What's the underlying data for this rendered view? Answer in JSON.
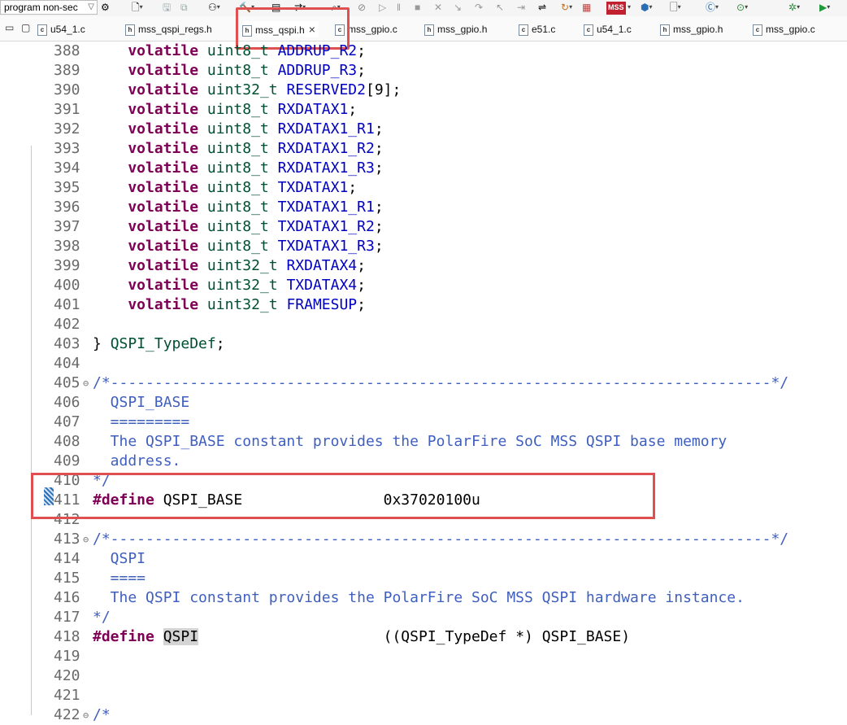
{
  "toolbar": {
    "run_config": "program non-sec",
    "icons": [
      "settings-icon",
      "new-file-icon",
      "save-icon",
      "save-all-icon",
      "debug-config-icon",
      "build-icon",
      "tools-icon",
      "console-icon",
      "search-icon",
      "skip-icon",
      "resume-icon",
      "suspend-icon",
      "terminate-icon",
      "disconnect-icon",
      "step-into-icon",
      "step-over-icon",
      "step-return-icon",
      "mss-configurator-icon",
      "external-tools-icon",
      "new-class-icon",
      "run-icon",
      "debug-icon"
    ],
    "mss_label": "MSS"
  },
  "view_controls": {
    "minimize": "▭",
    "maximize": "▢"
  },
  "tabs": [
    {
      "label": "u54_1.c",
      "type": "c",
      "active": false
    },
    {
      "label": "mss_qspi_regs.h",
      "type": "h",
      "active": false
    },
    {
      "label": "mss_qspi.h",
      "type": "h",
      "active": true
    },
    {
      "label": "mss_gpio.c",
      "type": "c",
      "active": false
    },
    {
      "label": "mss_gpio.h",
      "type": "h",
      "active": false
    },
    {
      "label": "e51.c",
      "type": "c",
      "active": false
    },
    {
      "label": "u54_1.c",
      "type": "c",
      "active": false
    },
    {
      "label": "mss_gpio.h",
      "type": "h",
      "active": false
    },
    {
      "label": "mss_gpio.c",
      "type": "c",
      "active": false
    }
  ],
  "tab_close_glyph": "×",
  "code_lines": [
    {
      "n": "388",
      "segs": [
        [
          "kw",
          "    volatile "
        ],
        [
          "ty",
          "uint8_t "
        ],
        [
          "fld",
          "ADDRUP_R2"
        ],
        [
          "txt",
          ";"
        ]
      ]
    },
    {
      "n": "389",
      "segs": [
        [
          "kw",
          "    volatile "
        ],
        [
          "ty",
          "uint8_t "
        ],
        [
          "fld",
          "ADDRUP_R3"
        ],
        [
          "txt",
          ";"
        ]
      ]
    },
    {
      "n": "390",
      "segs": [
        [
          "kw",
          "    volatile "
        ],
        [
          "ty",
          "uint32_t "
        ],
        [
          "fld",
          "RESERVED2"
        ],
        [
          "txt",
          "[9];"
        ]
      ]
    },
    {
      "n": "391",
      "segs": [
        [
          "kw",
          "    volatile "
        ],
        [
          "ty",
          "uint8_t "
        ],
        [
          "fld",
          "RXDATAX1"
        ],
        [
          "txt",
          ";"
        ]
      ]
    },
    {
      "n": "392",
      "segs": [
        [
          "kw",
          "    volatile "
        ],
        [
          "ty",
          "uint8_t "
        ],
        [
          "fld",
          "RXDATAX1_R1"
        ],
        [
          "txt",
          ";"
        ]
      ]
    },
    {
      "n": "393",
      "segs": [
        [
          "kw",
          "    volatile "
        ],
        [
          "ty",
          "uint8_t "
        ],
        [
          "fld",
          "RXDATAX1_R2"
        ],
        [
          "txt",
          ";"
        ]
      ]
    },
    {
      "n": "394",
      "segs": [
        [
          "kw",
          "    volatile "
        ],
        [
          "ty",
          "uint8_t "
        ],
        [
          "fld",
          "RXDATAX1_R3"
        ],
        [
          "txt",
          ";"
        ]
      ]
    },
    {
      "n": "395",
      "segs": [
        [
          "kw",
          "    volatile "
        ],
        [
          "ty",
          "uint8_t "
        ],
        [
          "fld",
          "TXDATAX1"
        ],
        [
          "txt",
          ";"
        ]
      ]
    },
    {
      "n": "396",
      "segs": [
        [
          "kw",
          "    volatile "
        ],
        [
          "ty",
          "uint8_t "
        ],
        [
          "fld",
          "TXDATAX1_R1"
        ],
        [
          "txt",
          ";"
        ]
      ]
    },
    {
      "n": "397",
      "segs": [
        [
          "kw",
          "    volatile "
        ],
        [
          "ty",
          "uint8_t "
        ],
        [
          "fld",
          "TXDATAX1_R2"
        ],
        [
          "txt",
          ";"
        ]
      ]
    },
    {
      "n": "398",
      "segs": [
        [
          "kw",
          "    volatile "
        ],
        [
          "ty",
          "uint8_t "
        ],
        [
          "fld",
          "TXDATAX1_R3"
        ],
        [
          "txt",
          ";"
        ]
      ]
    },
    {
      "n": "399",
      "segs": [
        [
          "kw",
          "    volatile "
        ],
        [
          "ty",
          "uint32_t "
        ],
        [
          "fld",
          "RXDATAX4"
        ],
        [
          "txt",
          ";"
        ]
      ]
    },
    {
      "n": "400",
      "segs": [
        [
          "kw",
          "    volatile "
        ],
        [
          "ty",
          "uint32_t "
        ],
        [
          "fld",
          "TXDATAX4"
        ],
        [
          "txt",
          ";"
        ]
      ]
    },
    {
      "n": "401",
      "segs": [
        [
          "kw",
          "    volatile "
        ],
        [
          "ty",
          "uint32_t "
        ],
        [
          "fld",
          "FRAMESUP"
        ],
        [
          "txt",
          ";"
        ]
      ]
    },
    {
      "n": "402",
      "segs": []
    },
    {
      "n": "403",
      "segs": [
        [
          "txt",
          "} "
        ],
        [
          "ty",
          "QSPI_TypeDef"
        ],
        [
          "txt",
          ";"
        ]
      ]
    },
    {
      "n": "404",
      "segs": []
    },
    {
      "n": "405",
      "fold": true,
      "segs": [
        [
          "cm",
          "/*---------------------------------------------------------------------------*/"
        ]
      ]
    },
    {
      "n": "406",
      "segs": [
        [
          "cm",
          "  QSPI_BASE"
        ]
      ]
    },
    {
      "n": "407",
      "segs": [
        [
          "cm",
          "  ========="
        ]
      ]
    },
    {
      "n": "408",
      "segs": [
        [
          "cm",
          "  The QSPI_BASE constant provides the PolarFire SoC MSS QSPI base memory"
        ]
      ]
    },
    {
      "n": "409",
      "segs": [
        [
          "cm",
          "  address."
        ]
      ]
    },
    {
      "n": "410",
      "segs": [
        [
          "cm",
          "*/"
        ]
      ]
    },
    {
      "n": "411",
      "segs": [
        [
          "pp",
          "#define "
        ],
        [
          "txt",
          "QSPI_BASE                0x37020100u"
        ]
      ]
    },
    {
      "n": "412",
      "segs": []
    },
    {
      "n": "413",
      "fold": true,
      "segs": [
        [
          "cm",
          "/*---------------------------------------------------------------------------*/"
        ]
      ]
    },
    {
      "n": "414",
      "segs": [
        [
          "cm",
          "  QSPI"
        ]
      ]
    },
    {
      "n": "415",
      "segs": [
        [
          "cm",
          "  ===="
        ]
      ]
    },
    {
      "n": "416",
      "segs": [
        [
          "cm",
          "  The QSPI constant provides the PolarFire SoC MSS QSPI hardware instance."
        ]
      ]
    },
    {
      "n": "417",
      "segs": [
        [
          "cm",
          "*/"
        ]
      ]
    },
    {
      "n": "418",
      "segs": [
        [
          "pp",
          "#define "
        ],
        [
          "sel",
          "QSPI"
        ],
        [
          "txt",
          "                     ((QSPI_TypeDef *) QSPI_BASE)"
        ]
      ]
    },
    {
      "n": "419",
      "segs": []
    },
    {
      "n": "420",
      "segs": []
    },
    {
      "n": "421",
      "segs": []
    },
    {
      "n": "422",
      "fold": true,
      "segs": [
        [
          "cm",
          "/*"
        ]
      ]
    }
  ]
}
